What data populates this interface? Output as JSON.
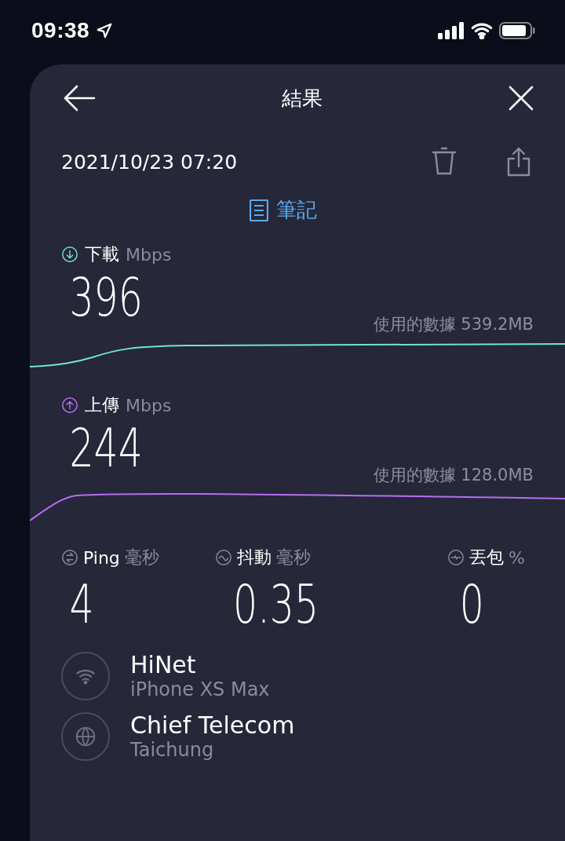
{
  "status_bar": {
    "time": "09:38"
  },
  "header": {
    "title": "結果"
  },
  "result": {
    "timestamp": "2021/10/23 07:20",
    "notes_label": "筆記"
  },
  "speeds": [
    {
      "kind": "download",
      "label": "下載",
      "unit": "Mbps",
      "value": "396",
      "data_used": "使用的數據 539.2MB",
      "color": "#6fe3d5"
    },
    {
      "kind": "upload",
      "label": "上傳",
      "unit": "Mbps",
      "value": "244",
      "data_used": "使用的數據 128.0MB",
      "color": "#b56ff0"
    }
  ],
  "metrics": [
    {
      "kind": "ping",
      "label": "Ping",
      "unit": "毫秒",
      "value": "4"
    },
    {
      "kind": "jitter",
      "label": "抖動",
      "unit": "毫秒",
      "value": "0.35"
    },
    {
      "kind": "loss",
      "label": "丟包",
      "unit": "%",
      "value": "0"
    }
  ],
  "connections": [
    {
      "kind": "network",
      "name": "HiNet",
      "detail": "iPhone XS Max"
    },
    {
      "kind": "server",
      "name": "Chief Telecom",
      "detail": "Taichung"
    }
  ]
}
